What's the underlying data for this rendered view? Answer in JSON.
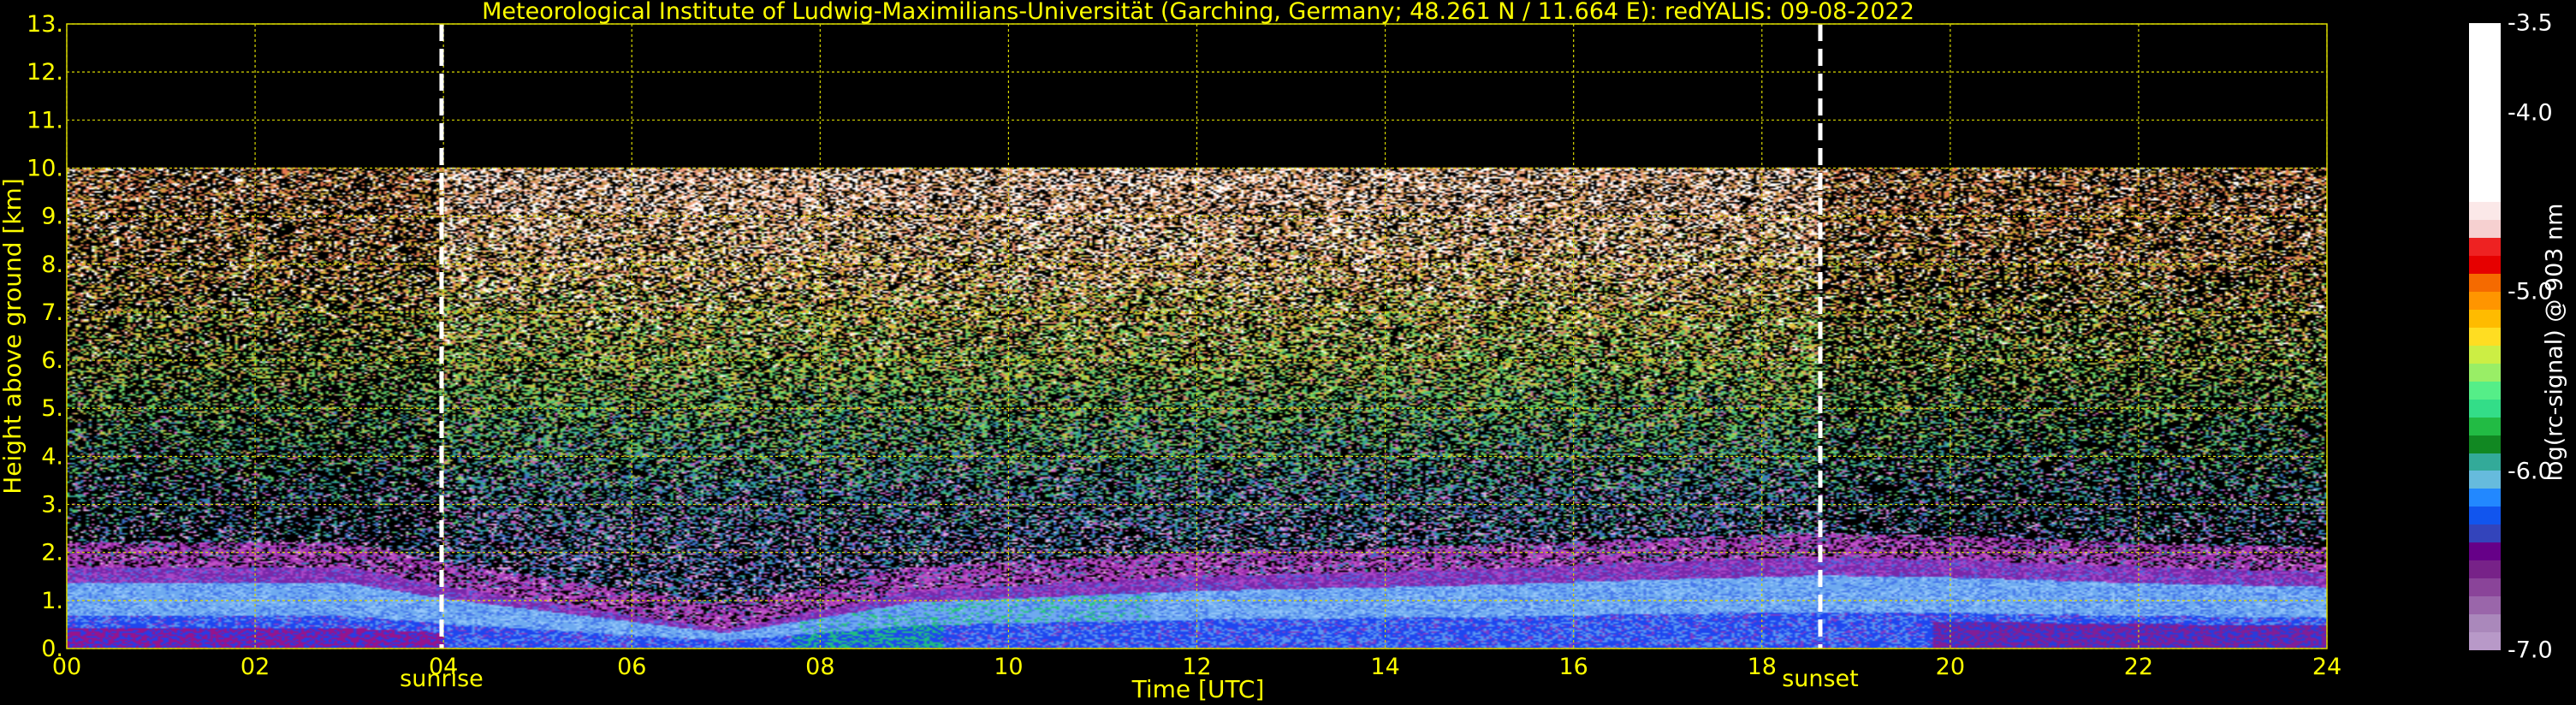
{
  "chart_data": {
    "type": "heatmap",
    "title": "Meteorological Institute of Ludwig-Maximilians-Universität (Garching, Germany; 48.261 N / 11.664 E):    redYALIS: 09-08-2022",
    "xlabel": "Time [UTC]",
    "ylabel": "Height above ground [km]",
    "xlim": [
      0,
      24
    ],
    "ylim": [
      0,
      13
    ],
    "x_ticks": [
      "00",
      "02",
      "04",
      "06",
      "08",
      "10",
      "12",
      "14",
      "16",
      "18",
      "20",
      "22",
      "24"
    ],
    "y_ticks": [
      "0.",
      "1.",
      "2.",
      "3.",
      "4.",
      "5.",
      "6.",
      "7.",
      "8.",
      "9.",
      "10.",
      "11.",
      "12.",
      "13."
    ],
    "grid": true,
    "signal_top_km": 10,
    "markers": [
      {
        "name": "sunrise",
        "time": 3.98
      },
      {
        "name": "sunset",
        "time": 18.62
      }
    ],
    "colorbar": {
      "label": "log(rc-signal) @ 903 nm",
      "range": [
        -7.0,
        -3.5
      ],
      "tick_labels": [
        "-3.5",
        "-4.0",
        "-5.0",
        "-6.0",
        "-7.0"
      ],
      "tick_values": [
        -3.5,
        -4.0,
        -5.0,
        -6.0,
        -7.0
      ]
    },
    "boundary_layer_top_km": [
      [
        0,
        1.7
      ],
      [
        3,
        1.7
      ],
      [
        4,
        1.3
      ],
      [
        7,
        0.4
      ],
      [
        8,
        0.8
      ],
      [
        9,
        1.2
      ],
      [
        12,
        1.5
      ],
      [
        15,
        1.65
      ],
      [
        17,
        1.8
      ],
      [
        18.6,
        1.9
      ],
      [
        20,
        1.85
      ],
      [
        22,
        1.7
      ],
      [
        24,
        1.6
      ]
    ]
  },
  "colors": {
    "text": "#ffff00",
    "grid": "#d8d800",
    "background": "#000000",
    "marker": "#ffffff"
  }
}
